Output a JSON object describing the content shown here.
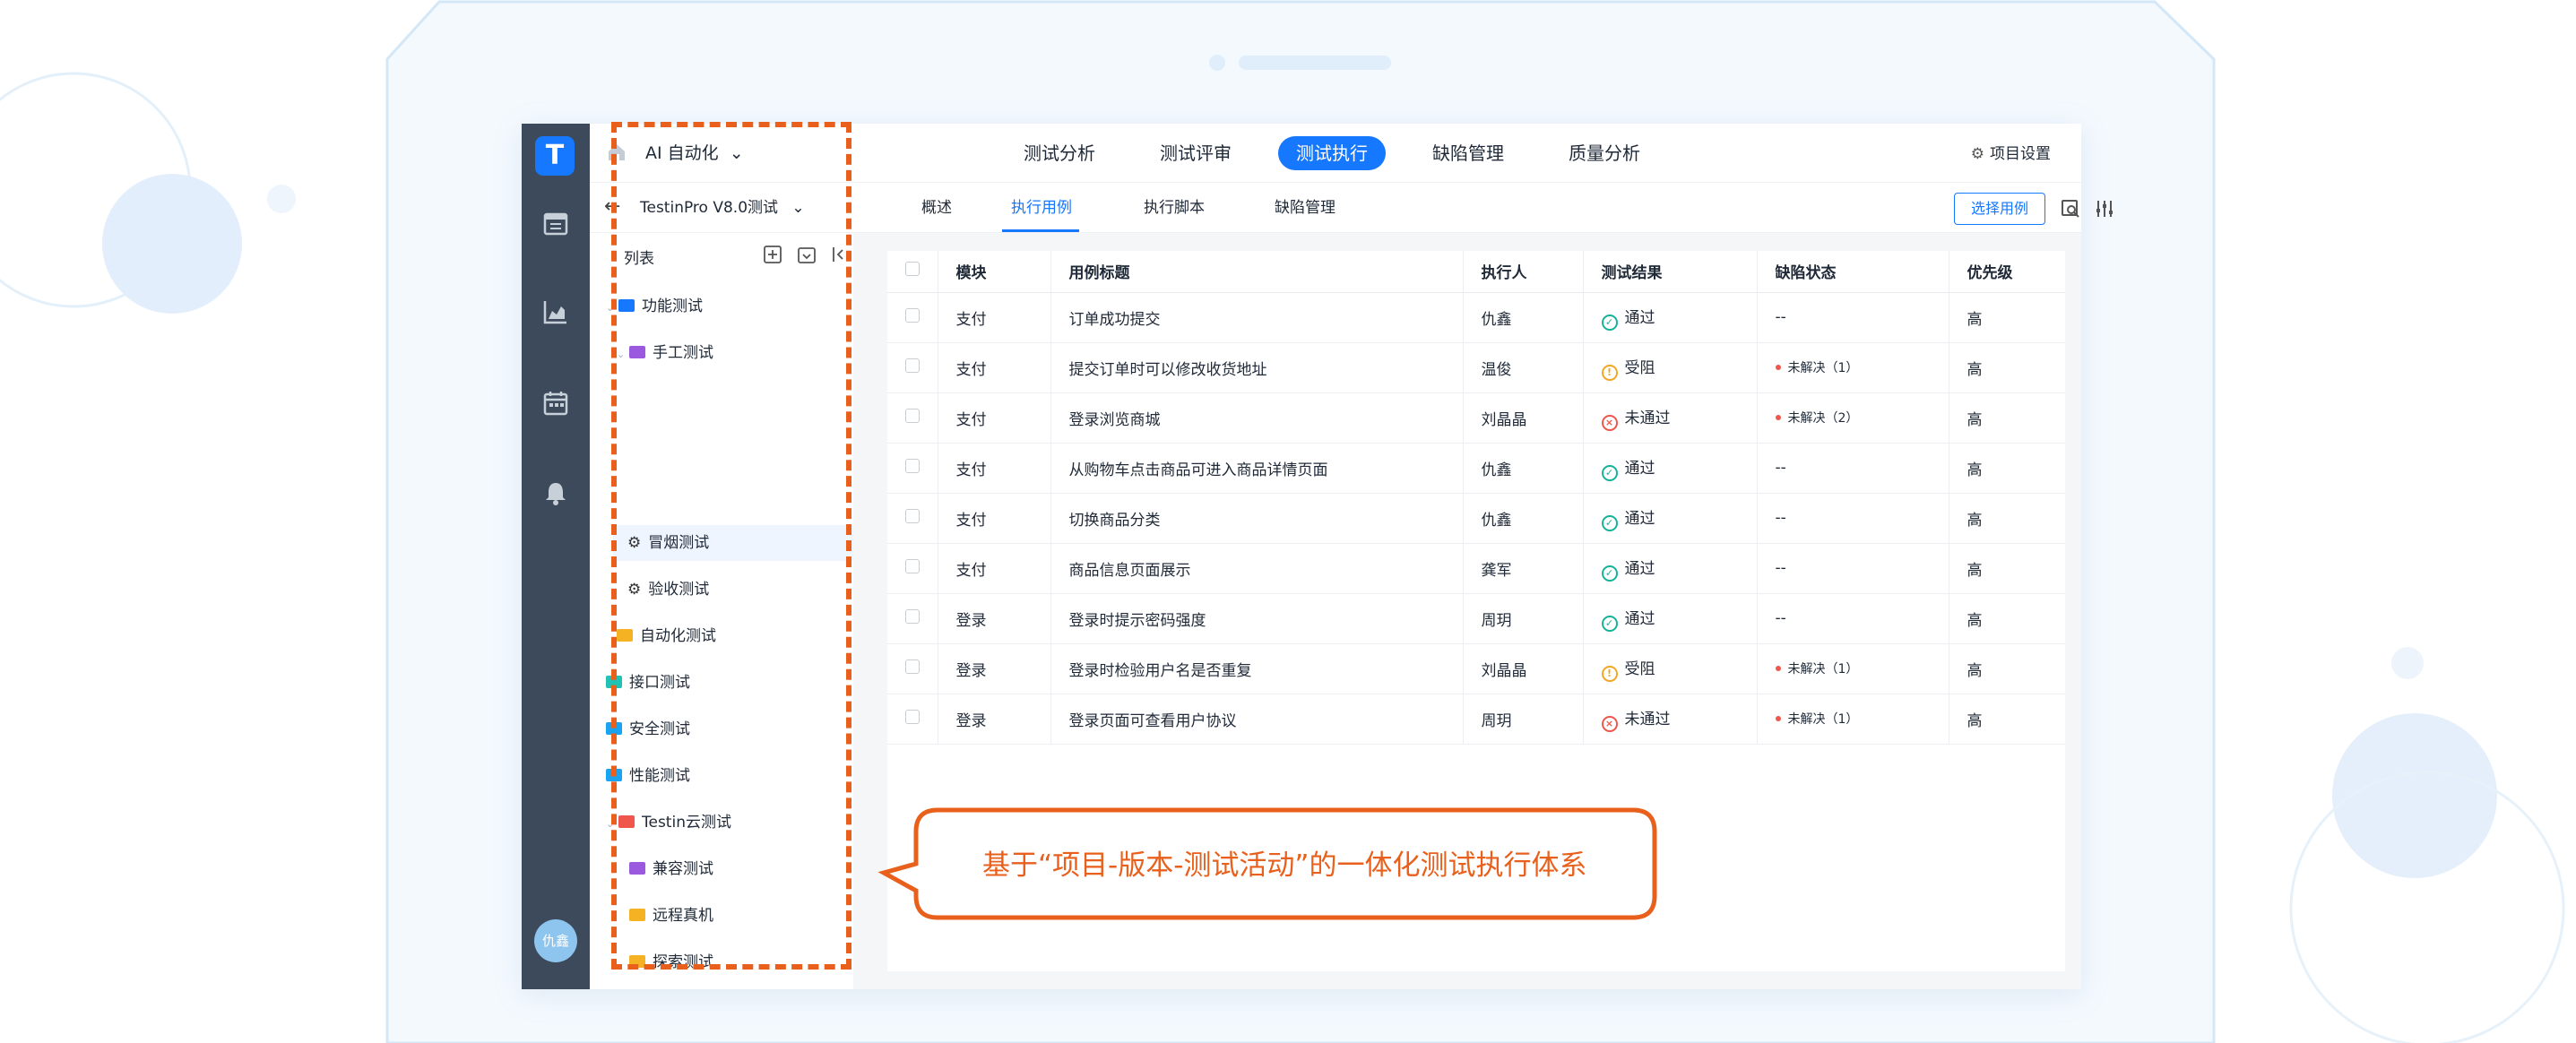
{
  "app": {
    "logo_letter": "T",
    "project_name": "AI 自动化",
    "main_tabs": [
      {
        "label": "测试分析",
        "active": false
      },
      {
        "label": "测试评审",
        "active": false
      },
      {
        "label": "测试执行",
        "active": true
      },
      {
        "label": "缺陷管理",
        "active": false
      },
      {
        "label": "质量分析",
        "active": false
      }
    ],
    "project_settings_label": "项目设置",
    "version_name": "TestinPro V8.0测试",
    "sub_tabs": [
      {
        "label": "概述",
        "active": false
      },
      {
        "label": "执行用例",
        "active": true
      },
      {
        "label": "执行脚本",
        "active": false
      },
      {
        "label": "缺陷管理",
        "active": false
      }
    ],
    "select_case_button": "选择用例",
    "avatar_text": "仇鑫",
    "accent_color": "#1677ff",
    "rail_color": "#3c4a5c",
    "rail_icons": [
      "calendar-board-icon",
      "chart-icon",
      "calendar-icon",
      "bell-icon"
    ]
  },
  "tree": {
    "title": "列表",
    "items": [
      {
        "label": "功能测试",
        "icon": "folder-blue",
        "color": "#1677ff",
        "expanded": true
      },
      {
        "label": "手工测试",
        "icon": "folder-purple",
        "color": "#9b59e0",
        "expanded": true
      },
      {
        "label": "冒烟测试",
        "icon": "gear-icon",
        "selected": true
      },
      {
        "label": "验收测试",
        "icon": "gear-icon"
      },
      {
        "label": "自动化测试",
        "icon": "folder-yellow",
        "color": "#f5b324"
      },
      {
        "label": "接口测试",
        "icon": "folder-teal",
        "color": "#21c2b4"
      },
      {
        "label": "安全测试",
        "icon": "folder-blue",
        "color": "#1aa3f0"
      },
      {
        "label": "性能测试",
        "icon": "folder-blue",
        "color": "#1aa3f0"
      },
      {
        "label": "Testin云测试",
        "icon": "folder-red",
        "color": "#f0564c",
        "expanded": true
      },
      {
        "label": "兼容测试",
        "icon": "folder-purple",
        "color": "#9b59e0"
      },
      {
        "label": "远程真机",
        "icon": "folder-yellow",
        "color": "#f5b324"
      },
      {
        "label": "探索测试",
        "icon": "folder-yellow",
        "color": "#f5b324"
      }
    ]
  },
  "table": {
    "headers": [
      "模块",
      "用例标题",
      "执行人",
      "测试结果",
      "缺陷状态",
      "优先级"
    ],
    "rows": [
      {
        "module": "支付",
        "title": "订单成功提交",
        "executor": "仇鑫",
        "result": "通过",
        "result_type": "pass",
        "defect": "--",
        "priority": "高"
      },
      {
        "module": "支付",
        "title": "提交订单时可以修改收货地址",
        "executor": "温俊",
        "result": "受阻",
        "result_type": "block",
        "defect": "未解决（1）",
        "priority": "高"
      },
      {
        "module": "支付",
        "title": "登录浏览商城",
        "executor": "刘晶晶",
        "result": "未通过",
        "result_type": "fail",
        "defect": "未解决（2）",
        "priority": "高"
      },
      {
        "module": "支付",
        "title": "从购物车点击商品可进入商品详情页面",
        "executor": "仇鑫",
        "result": "通过",
        "result_type": "pass",
        "defect": "--",
        "priority": "高"
      },
      {
        "module": "支付",
        "title": "切换商品分类",
        "executor": "仇鑫",
        "result": "通过",
        "result_type": "pass",
        "defect": "--",
        "priority": "高"
      },
      {
        "module": "支付",
        "title": "商品信息页面展示",
        "executor": "龚军",
        "result": "通过",
        "result_type": "pass",
        "defect": "--",
        "priority": "高"
      },
      {
        "module": "登录",
        "title": "登录时提示密码强度",
        "executor": "周玥",
        "result": "通过",
        "result_type": "pass",
        "defect": "--",
        "priority": "高"
      },
      {
        "module": "登录",
        "title": "登录时检验用户名是否重复",
        "executor": "刘晶晶",
        "result": "受阻",
        "result_type": "block",
        "defect": "未解决（1）",
        "priority": "高"
      },
      {
        "module": "登录",
        "title": "登录页面可查看用户协议",
        "executor": "周玥",
        "result": "未通过",
        "result_type": "fail",
        "defect": "未解决（1）",
        "priority": "高"
      }
    ]
  },
  "annotation": {
    "callout_text": "基于“项目-版本-测试活动”的一体化测试执行体系",
    "color": "#e8601c"
  }
}
